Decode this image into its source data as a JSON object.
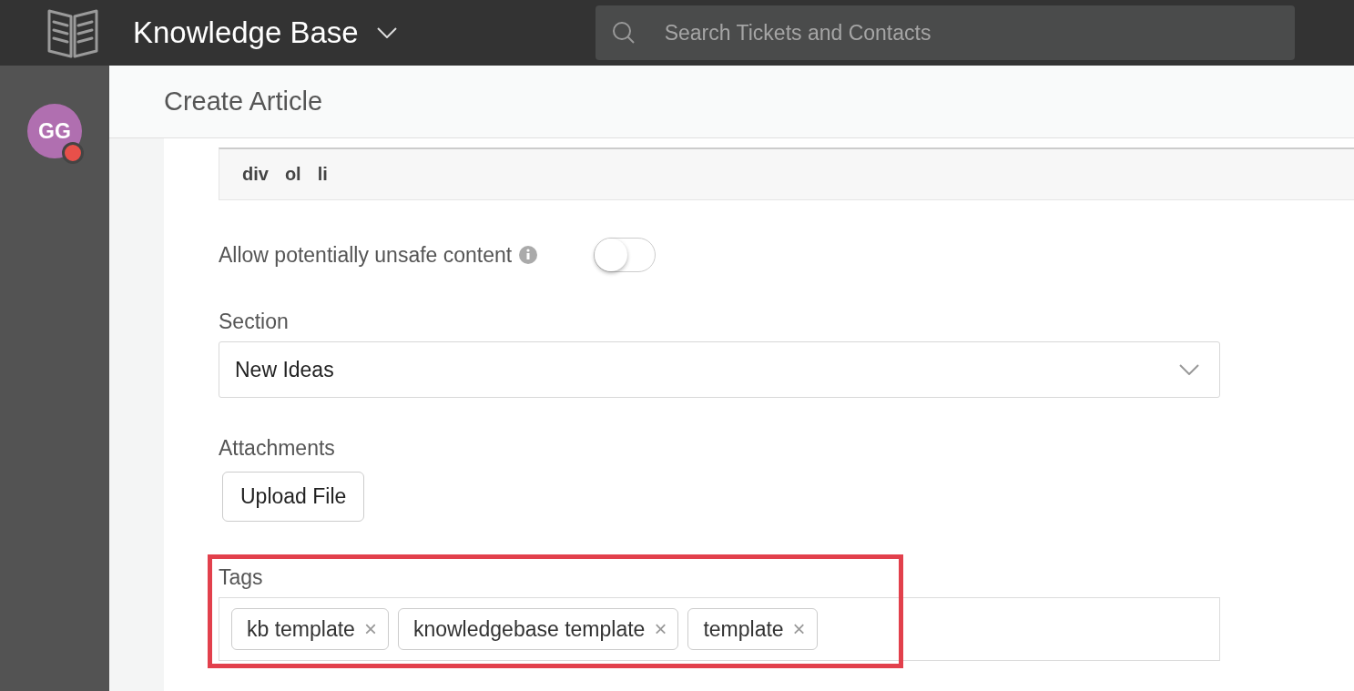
{
  "top_bar": {
    "title": "Knowledge Base",
    "search": {
      "placeholder": "Search Tickets and Contacts"
    }
  },
  "sidebar": {
    "avatar": {
      "initials": "GG"
    }
  },
  "page": {
    "title": "Create Article"
  },
  "editor": {
    "path": [
      "div",
      "ol",
      "li"
    ]
  },
  "unsafe_content": {
    "label": "Allow potentially unsafe content",
    "on": false
  },
  "section": {
    "label": "Section",
    "value": "New Ideas"
  },
  "attachments": {
    "label": "Attachments",
    "button": "Upload File"
  },
  "tags": {
    "label": "Tags",
    "highlighted": true,
    "items": [
      {
        "label": "kb template",
        "remove": "×"
      },
      {
        "label": "knowledgebase template",
        "remove": "×"
      },
      {
        "label": "template",
        "remove": "×"
      }
    ]
  }
}
